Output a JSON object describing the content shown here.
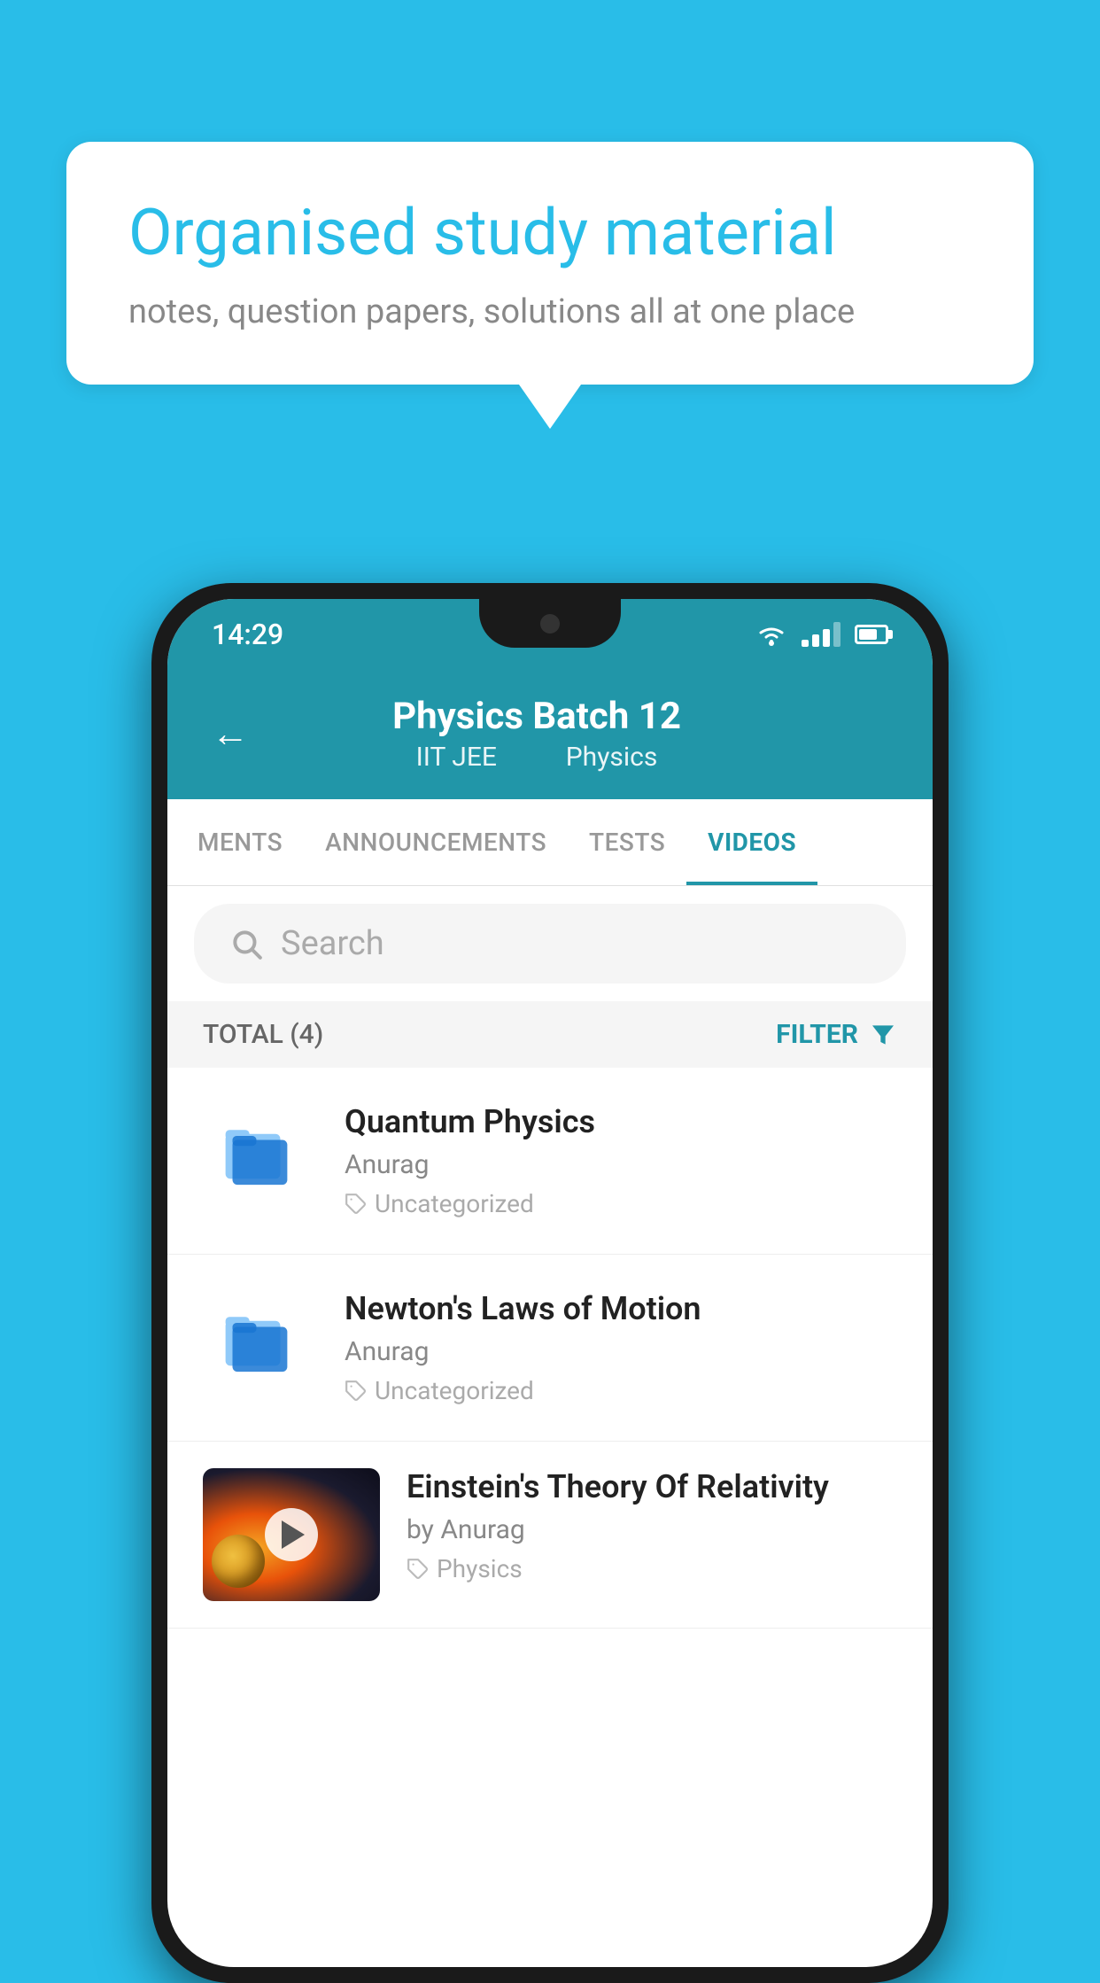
{
  "background_color": "#29bde8",
  "speech_bubble": {
    "title": "Organised study material",
    "subtitle": "notes, question papers, solutions all at one place"
  },
  "status_bar": {
    "time": "14:29"
  },
  "app_header": {
    "title": "Physics Batch 12",
    "subtitle_part1": "IIT JEE",
    "subtitle_part2": "Physics"
  },
  "tabs": [
    {
      "label": "MENTS",
      "active": false
    },
    {
      "label": "ANNOUNCEMENTS",
      "active": false
    },
    {
      "label": "TESTS",
      "active": false
    },
    {
      "label": "VIDEOS",
      "active": true
    }
  ],
  "search": {
    "placeholder": "Search"
  },
  "filter_row": {
    "total_label": "TOTAL (4)",
    "filter_label": "FILTER"
  },
  "videos": [
    {
      "title": "Quantum Physics",
      "author": "Anurag",
      "tag": "Uncategorized",
      "type": "folder"
    },
    {
      "title": "Newton's Laws of Motion",
      "author": "Anurag",
      "tag": "Uncategorized",
      "type": "folder"
    },
    {
      "title": "Einstein's Theory Of Relativity",
      "author": "by Anurag",
      "tag": "Physics",
      "type": "video"
    }
  ]
}
